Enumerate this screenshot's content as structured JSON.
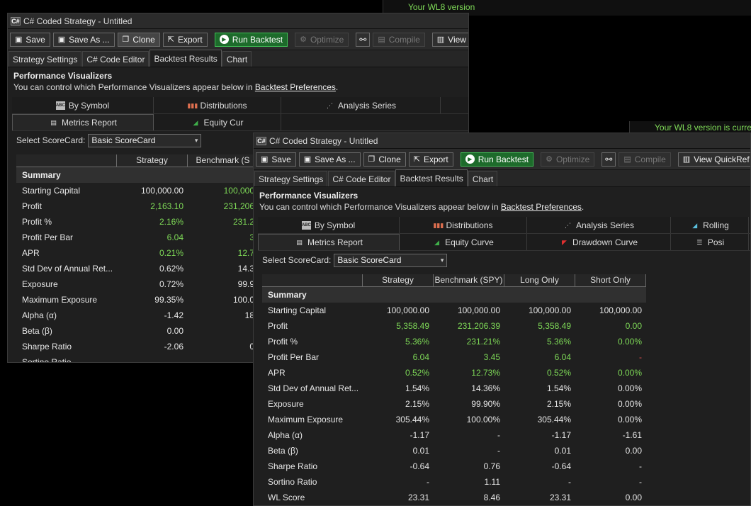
{
  "background": {
    "wl8_notice_top": "Your WL8 version",
    "wl8_notice_mid": "Your WL8 version is curre"
  },
  "windows": [
    {
      "title": "C# Coded Strategy - Untitled",
      "app_icon_text": "C#",
      "toolbar": {
        "save": "Save",
        "save_as": "Save As ...",
        "clone": "Clone",
        "export": "Export",
        "run_backtest": "Run Backtest",
        "optimize": "Optimize",
        "compile": "Compile",
        "view": "View"
      },
      "tabs": [
        "Strategy Settings",
        "C# Code Editor",
        "Backtest Results",
        "Chart"
      ],
      "active_tab": 2,
      "pv_title": "Performance Visualizers",
      "pv_sub_prefix": "You can control which Performance Visualizers appear below in ",
      "pv_sub_link": "Backtest Preferences",
      "pv_sub_suffix": ".",
      "visualizer_row1": [
        "By Symbol",
        "Distributions",
        "Analysis Series"
      ],
      "visualizer_row2": [
        "Metrics Report",
        "Equity Cur"
      ],
      "scorecard_label": "Select ScoreCard:",
      "scorecard_value": "Basic ScoreCard",
      "columns": [
        "Strategy",
        "Benchmark (S"
      ],
      "summary_label": "Summary",
      "rows": [
        {
          "label": "Starting Capital",
          "values": [
            "100,000.00",
            "100,000"
          ]
        },
        {
          "label": "Profit",
          "values": [
            "2,163.10",
            "231,206"
          ]
        },
        {
          "label": "Profit %",
          "values": [
            "2.16%",
            "231.2"
          ]
        },
        {
          "label": "Profit Per Bar",
          "values": [
            "6.04",
            "3"
          ]
        },
        {
          "label": "APR",
          "values": [
            "0.21%",
            "12.7"
          ]
        },
        {
          "label": "Std Dev of Annual Ret...",
          "values": [
            "0.62%",
            "14.3"
          ]
        },
        {
          "label": "Exposure",
          "values": [
            "0.72%",
            "99.9"
          ]
        },
        {
          "label": "Maximum Exposure",
          "values": [
            "99.35%",
            "100.0"
          ]
        },
        {
          "label": "Alpha (α)",
          "values": [
            "-1.42",
            "18"
          ]
        },
        {
          "label": "Beta (β)",
          "values": [
            "0.00",
            ""
          ]
        },
        {
          "label": "Sharpe Ratio",
          "values": [
            "-2.06",
            "0"
          ]
        },
        {
          "label": "Sortino Ratio",
          "values": [
            "-",
            ""
          ]
        }
      ],
      "colors": [
        [
          "",
          "pos"
        ],
        [
          "pos",
          "pos"
        ],
        [
          "pos",
          "pos"
        ],
        [
          "pos",
          "pos"
        ],
        [
          "pos",
          "pos"
        ],
        [
          "",
          ""
        ],
        [
          "",
          ""
        ],
        [
          "",
          ""
        ],
        [
          "",
          ""
        ],
        [
          "",
          ""
        ],
        [
          "",
          ""
        ],
        [
          "",
          ""
        ]
      ]
    },
    {
      "title": "C# Coded Strategy - Untitled",
      "app_icon_text": "C#",
      "toolbar": {
        "save": "Save",
        "save_as": "Save As ...",
        "clone": "Clone",
        "export": "Export",
        "run_backtest": "Run Backtest",
        "optimize": "Optimize",
        "compile": "Compile",
        "view": "View QuickRef"
      },
      "tabs": [
        "Strategy Settings",
        "C# Code Editor",
        "Backtest Results",
        "Chart"
      ],
      "active_tab": 2,
      "pv_title": "Performance Visualizers",
      "pv_sub_prefix": "You can control which Performance Visualizers appear below in ",
      "pv_sub_link": "Backtest Preferences",
      "pv_sub_suffix": ".",
      "visualizer_row1": [
        "By Symbol",
        "Distributions",
        "Analysis Series",
        "Rolling"
      ],
      "visualizer_row2": [
        "Metrics Report",
        "Equity Curve",
        "Drawdown Curve",
        "Posi"
      ],
      "scorecard_label": "Select ScoreCard:",
      "scorecard_value": "Basic ScoreCard",
      "columns": [
        "Strategy",
        "Benchmark (SPY)",
        "Long Only",
        "Short Only"
      ],
      "summary_label": "Summary",
      "rows": [
        {
          "label": "Starting Capital",
          "values": [
            "100,000.00",
            "100,000.00",
            "100,000.00",
            "100,000.00"
          ]
        },
        {
          "label": "Profit",
          "values": [
            "5,358.49",
            "231,206.39",
            "5,358.49",
            "0.00"
          ]
        },
        {
          "label": "Profit %",
          "values": [
            "5.36%",
            "231.21%",
            "5.36%",
            "0.00%"
          ]
        },
        {
          "label": "Profit Per Bar",
          "values": [
            "6.04",
            "3.45",
            "6.04",
            "-"
          ]
        },
        {
          "label": "APR",
          "values": [
            "0.52%",
            "12.73%",
            "0.52%",
            "0.00%"
          ]
        },
        {
          "label": "Std Dev of Annual Ret...",
          "values": [
            "1.54%",
            "14.36%",
            "1.54%",
            "0.00%"
          ]
        },
        {
          "label": "Exposure",
          "values": [
            "2.15%",
            "99.90%",
            "2.15%",
            "0.00%"
          ]
        },
        {
          "label": "Maximum Exposure",
          "values": [
            "305.44%",
            "100.00%",
            "305.44%",
            "0.00%"
          ]
        },
        {
          "label": "Alpha (α)",
          "values": [
            "-1.17",
            "-",
            "-1.17",
            "-1.61"
          ]
        },
        {
          "label": "Beta (β)",
          "values": [
            "0.01",
            "-",
            "0.01",
            "0.00"
          ]
        },
        {
          "label": "Sharpe Ratio",
          "values": [
            "-0.64",
            "0.76",
            "-0.64",
            "-"
          ]
        },
        {
          "label": "Sortino Ratio",
          "values": [
            "-",
            "1.11",
            "-",
            "-"
          ]
        },
        {
          "label": "WL Score",
          "values": [
            "23.31",
            "8.46",
            "23.31",
            "0.00"
          ]
        }
      ],
      "colors": [
        [
          "",
          "",
          "",
          ""
        ],
        [
          "pos",
          "pos",
          "pos",
          "pos"
        ],
        [
          "pos",
          "pos",
          "pos",
          "pos"
        ],
        [
          "pos",
          "pos",
          "pos",
          "neg"
        ],
        [
          "pos",
          "pos",
          "pos",
          "pos"
        ],
        [
          "",
          "",
          "",
          ""
        ],
        [
          "",
          "",
          "",
          ""
        ],
        [
          "",
          "",
          "",
          ""
        ],
        [
          "",
          "",
          "",
          ""
        ],
        [
          "",
          "",
          "",
          ""
        ],
        [
          "",
          "",
          "",
          ""
        ],
        [
          "",
          "",
          "",
          ""
        ],
        [
          "",
          "",
          "",
          ""
        ]
      ]
    }
  ]
}
